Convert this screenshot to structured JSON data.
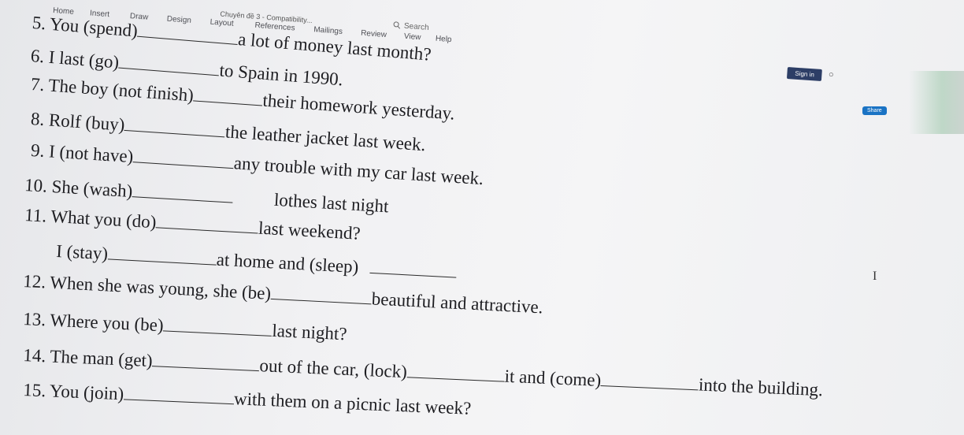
{
  "ribbon": {
    "tabs": [
      "Home",
      "Insert",
      "Draw",
      "Design",
      "Layout",
      "References",
      "Mailings",
      "Review",
      "View",
      "Help"
    ],
    "document_title": "Chuyên đề 3 - Compatibility...",
    "search_placeholder": "Search",
    "sign_in_label": "Sign in",
    "share_label": "Share"
  },
  "exercise": {
    "items": [
      {
        "num": "5.",
        "parts": [
          "You (spend)",
          "a lot of money last month?"
        ]
      },
      {
        "num": "6.",
        "parts": [
          "I last (go)",
          "to Spain in 1990."
        ]
      },
      {
        "num": "7.",
        "parts": [
          "The boy (not finish)",
          "their homework yesterday."
        ]
      },
      {
        "num": "8.",
        "parts": [
          "Rolf (buy)",
          "the leather jacket last week."
        ]
      },
      {
        "num": "9.",
        "parts": [
          "I (not have)",
          "any trouble with my car last week."
        ]
      },
      {
        "num": "10.",
        "parts": [
          "She (wash)",
          "lothes last night"
        ]
      },
      {
        "num": "11.",
        "parts": [
          "What you (do)",
          "last weekend?"
        ]
      },
      {
        "num": "",
        "parts": [
          "I (stay)",
          "at home and (sleep)",
          ""
        ]
      },
      {
        "num": "12.",
        "parts": [
          "When she was young, she (be)",
          "beautiful and attractive."
        ]
      },
      {
        "num": "13.",
        "parts": [
          "Where you (be)",
          "last night?"
        ]
      },
      {
        "num": "14.",
        "parts": [
          "The man (get)",
          "out of the car, (lock)",
          "it and (come)",
          "into the building."
        ]
      },
      {
        "num": "15.",
        "parts": [
          "You (join)",
          "with them on a picnic last week?"
        ]
      }
    ]
  }
}
